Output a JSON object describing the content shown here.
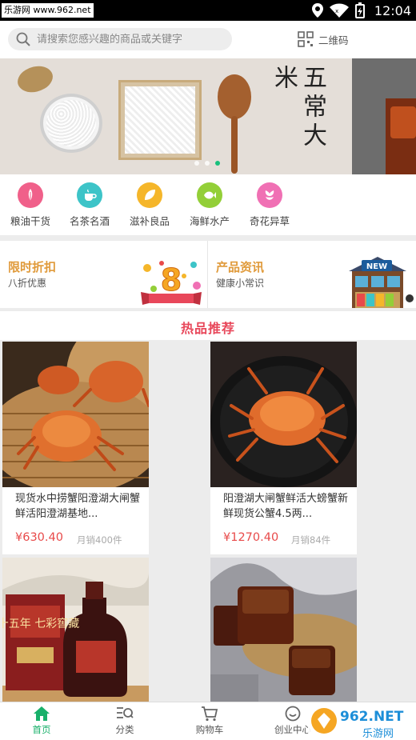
{
  "status_bar": {
    "watermark_text": "乐游网 www.962.net",
    "time": "12:04"
  },
  "header": {
    "search_placeholder": "请搜索您感兴趣的商品或关键字",
    "qr_label": "二维码"
  },
  "banner": {
    "title": "五常大米",
    "dot_count": 3,
    "active_dot": 3
  },
  "categories": [
    {
      "label": "粮油干货",
      "icon": "grain-icon",
      "color": "#f0608a"
    },
    {
      "label": "名茶名酒",
      "icon": "teacup-icon",
      "color": "#3dc4c8"
    },
    {
      "label": "滋补良品",
      "icon": "leaf-icon",
      "color": "#f5b62a"
    },
    {
      "label": "海鲜水产",
      "icon": "fish-icon",
      "color": "#93cf38"
    },
    {
      "label": "奇花异草",
      "icon": "flower-icon",
      "color": "#f070b4"
    }
  ],
  "promos": {
    "left": {
      "title": "限时折扣",
      "subtitle": "八折优惠",
      "badge": "8"
    },
    "right": {
      "title": "产品资讯",
      "subtitle": "健康小常识",
      "sign": "NEW"
    }
  },
  "hot": {
    "title": "热品推荐"
  },
  "products": [
    {
      "name": "现货水中捞蟹阳澄湖大闸蟹鲜活阳澄湖基地...",
      "price": "¥630.40",
      "sales": "月销400件"
    },
    {
      "name": "阳澄湖大闸蟹鲜活大螃蟹新鲜现货公蟹4.5两...",
      "price": "¥1270.40",
      "sales": "月销84件"
    },
    {
      "name": "",
      "price": "",
      "sales": "",
      "image_text": "十五年 七彩窖藏"
    },
    {
      "name": "",
      "price": "",
      "sales": ""
    }
  ],
  "bottom_nav": [
    {
      "label": "首页",
      "icon": "home-icon",
      "active": true
    },
    {
      "label": "分类",
      "icon": "category-search-icon",
      "active": false
    },
    {
      "label": "购物车",
      "icon": "cart-icon",
      "active": false
    },
    {
      "label": "创业中心",
      "icon": "smile-icon",
      "active": false
    }
  ],
  "watermark_br": {
    "line1": "962.NET",
    "line2": "乐游网"
  },
  "colors": {
    "accent_green": "#18b06a",
    "price_red": "#e84a4a",
    "hot_title": "#e8475a",
    "promo_orange": "#e09a3a"
  }
}
